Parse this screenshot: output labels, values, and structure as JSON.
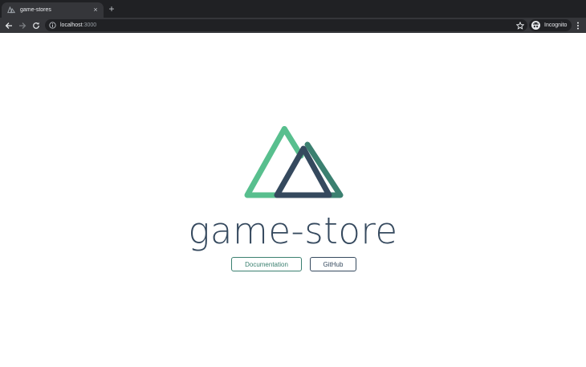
{
  "browser": {
    "tab": {
      "title": "game-stores",
      "close_icon": "×",
      "favicon": "nuxt-favicon-icon"
    },
    "new_tab_icon": "+",
    "address": {
      "host": "localhost",
      "port": ":3000"
    },
    "profile": {
      "label": "Incognito"
    }
  },
  "page": {
    "title": "game-store",
    "buttons": {
      "documentation": "Documentation",
      "github": "GitHub"
    },
    "colors": {
      "nuxt_green": "#58bf8e",
      "nuxt_teal": "#3b8070",
      "nuxt_dark": "#35495e"
    }
  }
}
